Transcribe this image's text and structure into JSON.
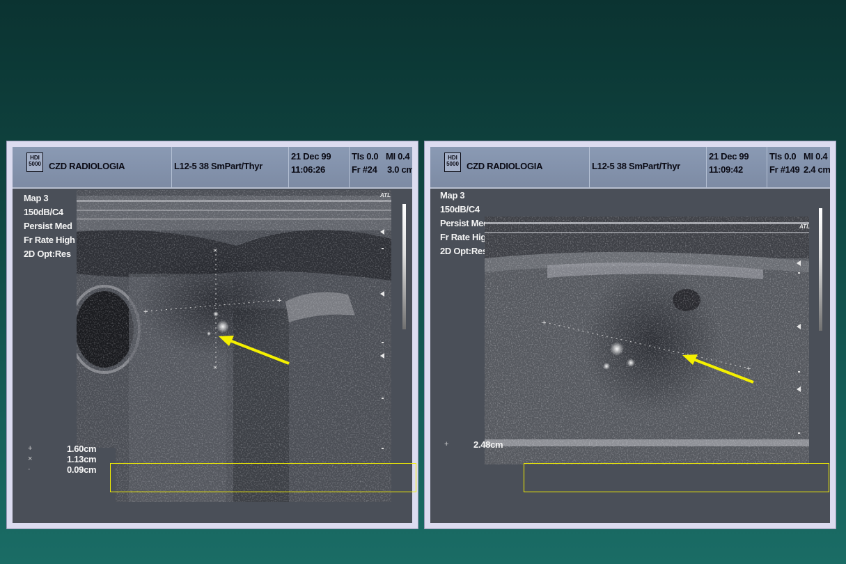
{
  "panels": [
    {
      "logo": "HDI 5000",
      "institution": "CZD RADIOLOGIA",
      "probe": "L12-5 38 SmPart/Thyr",
      "date": "21 Dec 99",
      "time": "11:06:26",
      "tis": "TIs 0.0",
      "mi": "MI 0.4",
      "frame": "Fr #24",
      "depth": "3.0 cm",
      "atl": "ATL",
      "settings": [
        "Map 3",
        "150dB/C4",
        "Persist Med",
        "Fr Rate High",
        "2D Opt:Res"
      ],
      "measurements": [
        {
          "marker": "+",
          "value": "1.60cm"
        },
        {
          "marker": "×",
          "value": "1.13cm"
        },
        {
          "marker": "·",
          "value": "0.09cm"
        }
      ]
    },
    {
      "logo": "HDI 5000",
      "institution": "CZD RADIOLOGIA",
      "probe": "L12-5 38 SmPart/Thyr",
      "date": "21 Dec 99",
      "time": "11:09:42",
      "tis": "TIs 0.0",
      "mi": "MI 0.4",
      "frame": "Fr #149",
      "depth": "2.4 cm",
      "atl": "ATL",
      "settings": [
        "Map 3",
        "150dB/C4",
        "Persist Med",
        "Fr Rate High",
        "2D Opt:Res"
      ],
      "measurements": [
        {
          "marker": "+",
          "value": "2.48cm"
        }
      ]
    }
  ],
  "colors": {
    "arrow": "#f4f000",
    "background": "#0f4541",
    "panel_border": "#dcdcf0"
  }
}
